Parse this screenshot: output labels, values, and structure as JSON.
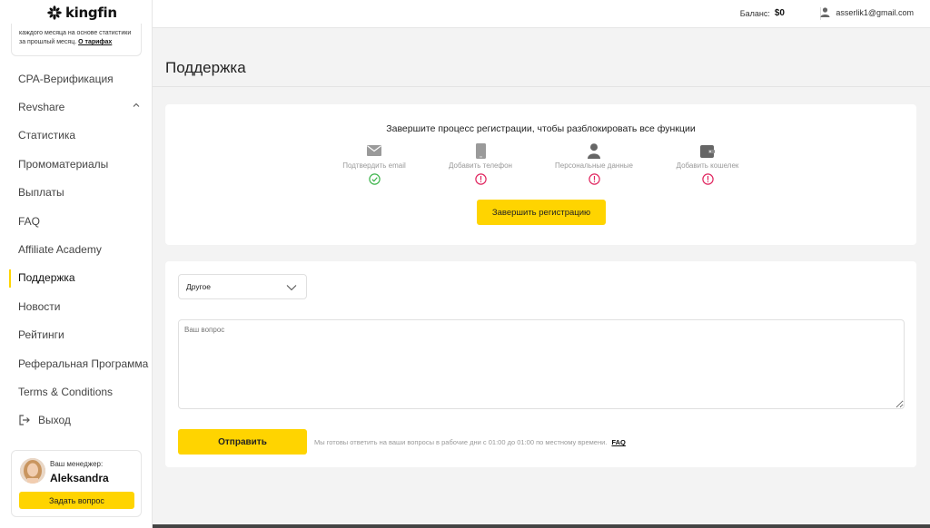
{
  "brand": {
    "name": "kingfin"
  },
  "promo": {
    "text": "каждого месяца на основе статистики за прошлый месяц.",
    "link": "О тарифах"
  },
  "sidebar": {
    "items": [
      {
        "label": "CPA-Верификация"
      },
      {
        "label": "Revshare"
      },
      {
        "label": "Статистика"
      },
      {
        "label": "Промоматериалы"
      },
      {
        "label": "Выплаты"
      },
      {
        "label": "FAQ"
      },
      {
        "label": "Affiliate Academy"
      },
      {
        "label": "Поддержка"
      },
      {
        "label": "Новости"
      },
      {
        "label": "Рейтинги"
      },
      {
        "label": "Реферальная Программа"
      },
      {
        "label": "Terms & Conditions"
      },
      {
        "label": "Выход"
      }
    ],
    "active": "Поддержка"
  },
  "manager": {
    "label": "Ваш менеджер:",
    "name": "Aleksandra",
    "button": "Задать вопрос"
  },
  "header": {
    "balance_label": "Баланс:",
    "balance_value": "$0",
    "user_email": "asserlik1@gmail.com"
  },
  "page": {
    "title": "Поддержка"
  },
  "registration": {
    "title": "Завершите процесс регистрации, чтобы разблокировать все функции",
    "steps": [
      {
        "label": "Подтвердить email",
        "icon": "mail-icon",
        "status": "done"
      },
      {
        "label": "Добавить телефон",
        "icon": "phone-icon",
        "status": "pending"
      },
      {
        "label": "Персональные данные",
        "icon": "person-icon",
        "status": "pending"
      },
      {
        "label": "Добавить кошелек",
        "icon": "wallet-icon",
        "status": "pending"
      }
    ],
    "button": "Завершить регистрацию"
  },
  "form": {
    "category_value": "Другое",
    "question_placeholder": "Ваш вопрос",
    "submit": "Отправить",
    "hint": "Мы готовы ответить на ваши вопросы в рабочие дни с 01:00 до 01:00 по местному времени.",
    "faq_link": "FAQ"
  },
  "colors": {
    "accent": "#ffd400",
    "success": "#3cb44b",
    "warning": "#e0245e"
  }
}
